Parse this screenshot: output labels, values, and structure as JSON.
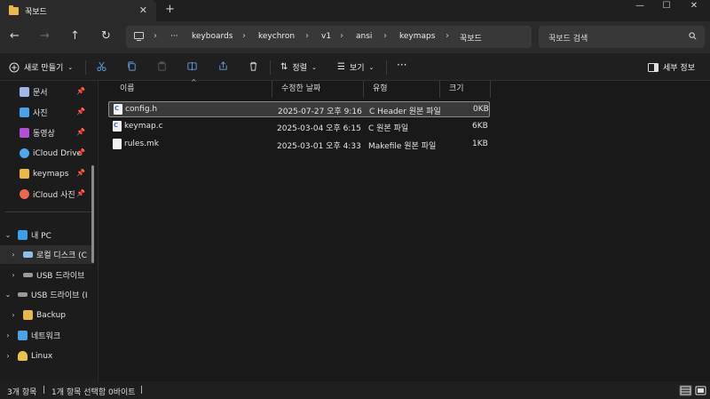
{
  "tab": {
    "title": "꾹보드",
    "close": "✕",
    "new": "+"
  },
  "window_controls": {
    "minimize": "—",
    "maximize": "☐",
    "close": "✕"
  },
  "nav": {
    "back": "←",
    "forward": "→",
    "up": "↑",
    "refresh": "↻"
  },
  "address": {
    "more": "···",
    "crumbs": [
      "keyboards",
      "keychron",
      "v1",
      "ansi",
      "keymaps",
      "꾹보드"
    ],
    "separator": "›"
  },
  "search": {
    "placeholder": "꾹보드 검색"
  },
  "toolbar": {
    "new_label": "새로 만들기",
    "sort_label": "정렬",
    "view_label": "보기",
    "more": "···",
    "details_label": "세부 정보"
  },
  "sidebar": {
    "quick": [
      {
        "label": "문서",
        "pin": "📌",
        "icon_color": "#9fb8e8"
      },
      {
        "label": "사진",
        "pin": "📌",
        "icon_color": "#4aa3e8"
      },
      {
        "label": "동영상",
        "pin": "📌",
        "icon_color": "#b14fd6"
      },
      {
        "label": "iCloud Drive",
        "pin": "📌",
        "icon_color": "#4fa8e8"
      },
      {
        "label": "keymaps",
        "pin": "📌",
        "icon_color": "#e8b94a"
      },
      {
        "label": "iCloud 사진",
        "pin": "📌",
        "icon_color": "#e86a4a"
      }
    ],
    "tree": [
      {
        "label": "내 PC",
        "chev": "⌄",
        "icon_color": "#3aa0e8"
      },
      {
        "label": "로컬 디스크 (C",
        "chev": "›",
        "icon_color": "#8fbfe8"
      },
      {
        "label": "USB 드라이브",
        "chev": "›",
        "icon_color": "#9a9a9a"
      },
      {
        "label": "USB 드라이브 (I",
        "chev": "⌄",
        "icon_color": "#9a9a9a"
      },
      {
        "label": "Backup",
        "chev": "›",
        "icon_color": "#e8b94a"
      },
      {
        "label": "네트워크",
        "chev": "›",
        "icon_color": "#4aa3e8"
      },
      {
        "label": "Linux",
        "chev": "›",
        "icon_color": "#e8c24a"
      }
    ]
  },
  "columns": {
    "name": "이름",
    "date": "수정한 날짜",
    "type": "유형",
    "size": "크기",
    "sort_caret": "^"
  },
  "files": [
    {
      "name": "config.h",
      "date": "2025-07-27 오후 9:16",
      "type": "C Header 원본 파일",
      "size": "0KB",
      "icon": "C"
    },
    {
      "name": "keymap.c",
      "date": "2025-03-04 오후 6:15",
      "type": "C 원본 파일",
      "size": "6KB",
      "icon": "C"
    },
    {
      "name": "rules.mk",
      "date": "2025-03-01 오후 4:33",
      "type": "Makefile 원본 파일",
      "size": "1KB",
      "icon": ""
    }
  ],
  "status": {
    "count": "3개 항목",
    "selection": "1개 항목 선택함 0바이트",
    "bar": "|"
  },
  "colors": {
    "accent": "#4aa3e8",
    "folder": "#e8b94a",
    "bg": "#1c1c1c"
  }
}
